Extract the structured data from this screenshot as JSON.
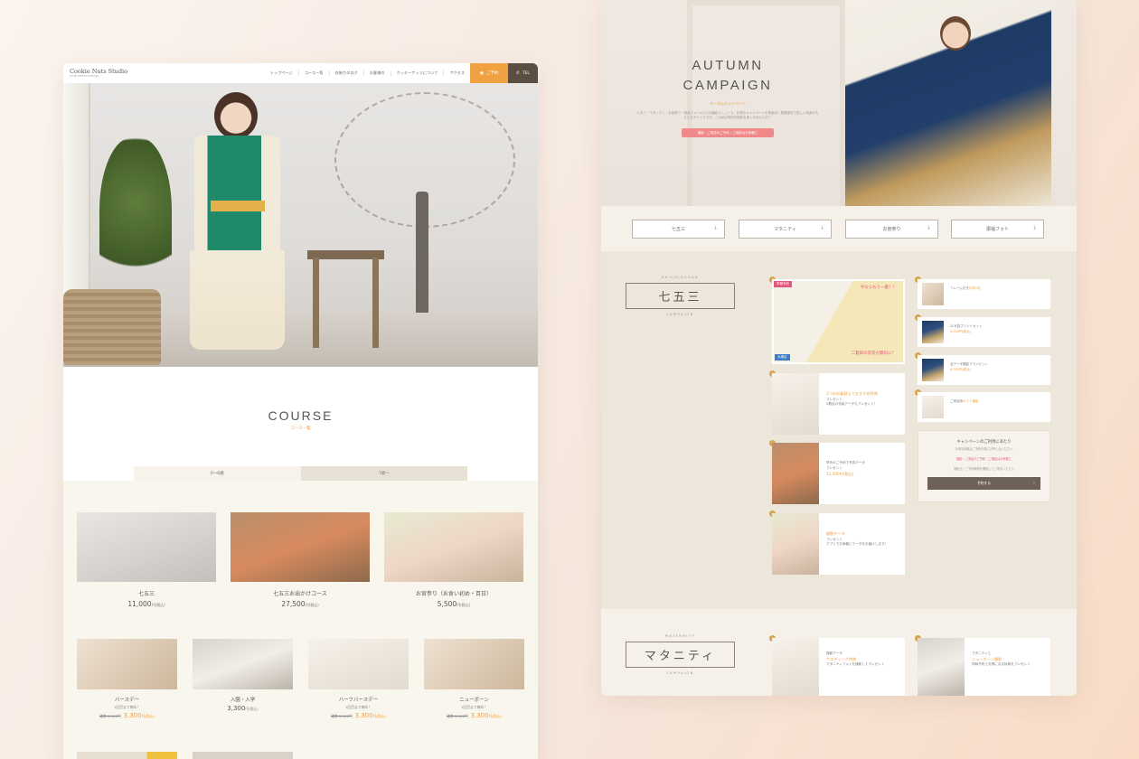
{
  "left": {
    "logo": {
      "name": "Cookie Nuts Studio",
      "sub": "CUTE PHOTO STUDIO"
    },
    "nav": [
      "トップページ",
      "コース一覧",
      "衣装カタログ",
      "お客様の",
      "クッキーナッツについて",
      "アクセス"
    ],
    "reserve_label": "ご予約",
    "tel_label": "TEL",
    "course": {
      "title": "COURSE",
      "subtitle": "コース一覧"
    },
    "tabs": [
      "0〜6歳",
      "7歳〜"
    ],
    "cards_main": [
      {
        "label": "七五三",
        "price": "11,000",
        "unit": "円(税込)"
      },
      {
        "label": "七五三お出かけコース",
        "price": "27,500",
        "unit": "円(税込)"
      },
      {
        "label": "お宮参り（お食い初め・百日）",
        "price": "5,500",
        "unit": "円(税込)"
      }
    ],
    "cards_sub": [
      {
        "label": "バースデー",
        "note": "1回目まで無料！",
        "old": "通常 5,500円",
        "price": "3,300",
        "unit": "円(税込)"
      },
      {
        "label": "入園・入学",
        "note": "",
        "old": "",
        "price": "3,300",
        "unit": "円(税込)"
      },
      {
        "label": "ハーフバースデー",
        "note": "1回目まで無料！",
        "old": "通常 5,500円",
        "price": "3,300",
        "unit": "円(税込)"
      },
      {
        "label": "ニューボーン",
        "note": "1回目まで無料！",
        "old": "通常 5,500円",
        "price": "3,300",
        "unit": "円(税込)"
      }
    ]
  },
  "right": {
    "campaign": {
      "title_line1": "AUTUMN",
      "title_line2": "CAMPAIGN",
      "subtitle": "オータムキャンペーン",
      "desc": "七五三・マタニティ・お宮参り・振袖フォトの4つの撮影メニューで、お得なキャンペーンを実施中！期間限定で嬉しい特典がもらえるチャンスです。この秋は特別な撮影を楽しみませんか？",
      "cta": "撮影・ご来店のご予約・ご相談はお気軽に"
    },
    "tabs": [
      "七五三",
      "マタニティ",
      "お宮参り",
      "振袖フォト"
    ],
    "shichigosan": {
      "eng": "SHICHIGOSAN",
      "label": "七五三",
      "campaign": "CAMPAIGN",
      "big_card": {
        "tag": "早期予約",
        "top": "今ならもう一着！！",
        "caption": "二着目の衣装が無料に！",
        "corner": "大満足"
      },
      "mid_cards": [
        {
          "hl": "3つのお着替えでおすすめ特典",
          "sub": "プレゼント",
          "note": "2着目の衣装データもプレゼント！"
        },
        {
          "hl": "11,000円(税込)",
          "sub": "早めのご予約で写真データ",
          "note": "プレゼント"
        },
        {
          "hl": "撮影データ",
          "sub": "プレゼント",
          "note": "アプリでお気軽にデータをお届けします！"
        }
      ],
      "small_cards": [
        {
          "text": "フレーム付き",
          "hl": "写真1枚"
        },
        {
          "text": "2L写真プリントセット",
          "hl": "4,000円(税込)"
        },
        {
          "text": "全データ撮影プランセット",
          "hl": "6,000円(税込)"
        },
        {
          "text": "ご来店時",
          "hl": "ギフト撮影"
        }
      ],
      "notice": {
        "title": "キャンペーンのご利用にあたり",
        "line1": "お得な特典はご予約の際にお申し出ください",
        "line2": "撮影・ご来店のご予約・ご相談はお気軽に",
        "line3": "撮影日・ご予約時間を確認してご来店ください",
        "button": "予約する"
      }
    },
    "maternity": {
      "eng": "MATERNITY",
      "label": "マタニティ",
      "campaign": "CAMPAIGN",
      "cards": [
        {
          "sub": "撮影データ",
          "hl": "ウエディング特典",
          "note": "マタニティフォトを撮影してプレゼント"
        },
        {
          "sub": "マタニティと",
          "hl": "ニューボーン撮影",
          "note": "同時予約でお得になる特典をプレゼント"
        }
      ]
    }
  },
  "colors": {
    "accent": "#f0a141",
    "dark": "#5a4d42",
    "pink": "#e3557a"
  }
}
